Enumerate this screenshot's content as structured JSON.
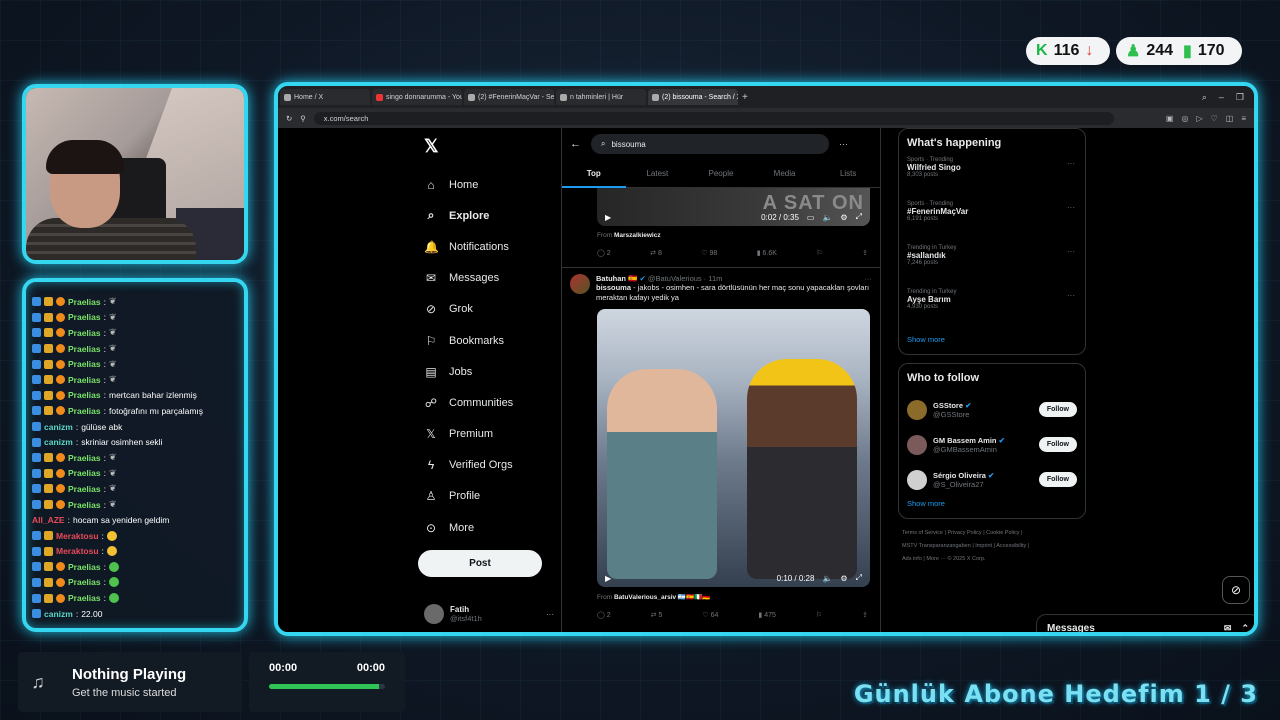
{
  "stats": {
    "k_count": "116",
    "followers": "244",
    "views": "170"
  },
  "browser": {
    "tabs": [
      {
        "label": "Home / X",
        "icon": "x-icon"
      },
      {
        "label": "singo donnarumma - You",
        "icon": "youtube-icon"
      },
      {
        "label": "(2) #FenerinMaçVar - Sea",
        "icon": "x-icon"
      },
      {
        "label": "n tahminleri | Hür",
        "icon": "globe-icon"
      },
      {
        "label": "(2) bissouma - Search / X",
        "icon": "x-icon"
      }
    ],
    "url": "x.com/search"
  },
  "nav": [
    {
      "label": "Home",
      "icon": "home-icon"
    },
    {
      "label": "Explore",
      "icon": "search-icon"
    },
    {
      "label": "Notifications",
      "icon": "bell-icon"
    },
    {
      "label": "Messages",
      "icon": "mail-icon"
    },
    {
      "label": "Grok",
      "icon": "grok-icon"
    },
    {
      "label": "Bookmarks",
      "icon": "bookmark-icon"
    },
    {
      "label": "Jobs",
      "icon": "briefcase-icon"
    },
    {
      "label": "Communities",
      "icon": "people-icon"
    },
    {
      "label": "Premium",
      "icon": "x-icon"
    },
    {
      "label": "Verified Orgs",
      "icon": "lightning-icon"
    },
    {
      "label": "Profile",
      "icon": "person-icon"
    },
    {
      "label": "More",
      "icon": "more-circle-icon"
    }
  ],
  "post_label": "Post",
  "me": {
    "name": "Fatih",
    "handle": "@itsf4t1h"
  },
  "search": {
    "query": "bissouma"
  },
  "feed_tabs": [
    "Top",
    "Latest",
    "People",
    "Media",
    "Lists"
  ],
  "tweet1": {
    "video_time": "0:02 / 0:35",
    "video_text": "A SAT ON",
    "from_prefix": "From",
    "from": "Marszalkiewicz",
    "replies": "2",
    "reposts": "8",
    "likes": "98",
    "views": "6.6K"
  },
  "tweet2": {
    "name": "Batuhan",
    "flag": "🇪🇸",
    "handle": "@BatuValerious",
    "time": "· 11m",
    "text_bold": "bissouma",
    "text": " - jakobs - osimhen - sara dörtlüsünün her maç sonu yapacakları şovları meraktan kafayı yedik ya",
    "video_time": "0:10 / 0:28",
    "from_prefix": "From",
    "from": "BatuValerious_arsiv 🇦🇷🇪🇸🇮🇹🇩🇪",
    "replies": "2",
    "reposts": "5",
    "likes": "64",
    "views": "475"
  },
  "whats_happening": {
    "title": "What's happening",
    "trends": [
      {
        "category": "Sports · Trending",
        "title": "Wilfried Singo",
        "posts": "8,303 posts"
      },
      {
        "category": "Sports · Trending",
        "title": "#FenerinMaçVar",
        "posts": "6,191 posts"
      },
      {
        "category": "Trending in Turkey",
        "title": "#sallandık",
        "posts": "7,246 posts"
      },
      {
        "category": "Trending in Turkey",
        "title": "Ayşe Barım",
        "posts": "4,930 posts"
      }
    ],
    "show_more": "Show more"
  },
  "who_to_follow": {
    "title": "Who to follow",
    "accounts": [
      {
        "name": "GSStore",
        "handle": "@GSStore"
      },
      {
        "name": "GM Bassem Amin",
        "handle": "@GMBassemAmin"
      },
      {
        "name": "Sérgio Oliveira",
        "handle": "@S_Oliveira27"
      }
    ],
    "follow_label": "Follow",
    "show_more": "Show more"
  },
  "footer": {
    "line1": "Terms of Service  |  Privacy Policy  |  Cookie Policy  |",
    "line2": "MSTV Transparanzangaben  |  Imprint  |  Accessibility  |",
    "line3": "Ads info  |  More ···  © 2025 X Corp."
  },
  "messages_dock": "Messages",
  "chat": [
    {
      "badges": [
        "blue",
        "gold",
        "orange"
      ],
      "user": "Praelias",
      "color": "green",
      "msg": "",
      "emote": "leaf"
    },
    {
      "badges": [
        "blue",
        "gold",
        "orange"
      ],
      "user": "Praelias",
      "color": "green",
      "msg": "",
      "emote": "leaf"
    },
    {
      "badges": [
        "blue",
        "gold",
        "orange"
      ],
      "user": "Praelias",
      "color": "green",
      "msg": "",
      "emote": "leaf"
    },
    {
      "badges": [
        "blue",
        "gold",
        "orange"
      ],
      "user": "Praelias",
      "color": "green",
      "msg": "",
      "emote": "leaf"
    },
    {
      "badges": [
        "blue",
        "gold",
        "orange"
      ],
      "user": "Praelias",
      "color": "green",
      "msg": "",
      "emote": "leaf"
    },
    {
      "badges": [
        "blue",
        "gold",
        "orange"
      ],
      "user": "Praelias",
      "color": "green",
      "msg": "",
      "emote": "leaf"
    },
    {
      "badges": [
        "blue",
        "gold",
        "orange"
      ],
      "user": "Praelias",
      "color": "green",
      "msg": "mertcan bahar izlenmiş",
      "emote": ""
    },
    {
      "badges": [
        "blue",
        "gold",
        "orange"
      ],
      "user": "Praelias",
      "color": "green",
      "msg": "fotoğrafını mı parçalamış",
      "emote": ""
    },
    {
      "badges": [
        "blue"
      ],
      "user": "canizm",
      "color": "teal",
      "msg": "gülüse abk",
      "emote": ""
    },
    {
      "badges": [
        "blue"
      ],
      "user": "canizm",
      "color": "teal",
      "msg": "skriniar osimhen sekli",
      "emote": ""
    },
    {
      "badges": [
        "blue",
        "gold",
        "orange"
      ],
      "user": "Praelias",
      "color": "green",
      "msg": "",
      "emote": "leaf"
    },
    {
      "badges": [
        "blue",
        "gold",
        "orange"
      ],
      "user": "Praelias",
      "color": "green",
      "msg": "",
      "emote": "leaf"
    },
    {
      "badges": [
        "blue",
        "gold",
        "orange"
      ],
      "user": "Praelias",
      "color": "green",
      "msg": "",
      "emote": "leaf"
    },
    {
      "badges": [
        "blue",
        "gold",
        "orange"
      ],
      "user": "Praelias",
      "color": "green",
      "msg": "",
      "emote": "leaf"
    },
    {
      "badges": [],
      "user": "All_AZE",
      "color": "red",
      "msg": "hocam sa yeniden geldim",
      "emote": ""
    },
    {
      "badges": [
        "blue",
        "gold"
      ],
      "user": "Meraktosu",
      "color": "red",
      "msg": "",
      "emote": "yellow"
    },
    {
      "badges": [
        "blue",
        "gold"
      ],
      "user": "Meraktosu",
      "color": "red",
      "msg": "",
      "emote": "yellow"
    },
    {
      "badges": [
        "blue",
        "gold",
        "orange"
      ],
      "user": "Praelias",
      "color": "green",
      "msg": "",
      "emote": "green"
    },
    {
      "badges": [
        "blue",
        "gold",
        "orange"
      ],
      "user": "Praelias",
      "color": "green",
      "msg": "",
      "emote": "green"
    },
    {
      "badges": [
        "blue",
        "gold",
        "orange"
      ],
      "user": "Praelias",
      "color": "green",
      "msg": "",
      "emote": "green"
    },
    {
      "badges": [
        "blue"
      ],
      "user": "canizm",
      "color": "teal",
      "msg": "22.00",
      "emote": ""
    }
  ],
  "music": {
    "title": "Nothing Playing",
    "subtitle": "Get the music started",
    "time_left": "00:00",
    "time_right": "00:00",
    "progress": 0.95
  },
  "goal": "Günlük Abone Hedefim  1 / 3",
  "colors": {
    "neon": "#35d6f0",
    "x_blue": "#1d9bf0",
    "music_green": "#2fc455"
  }
}
